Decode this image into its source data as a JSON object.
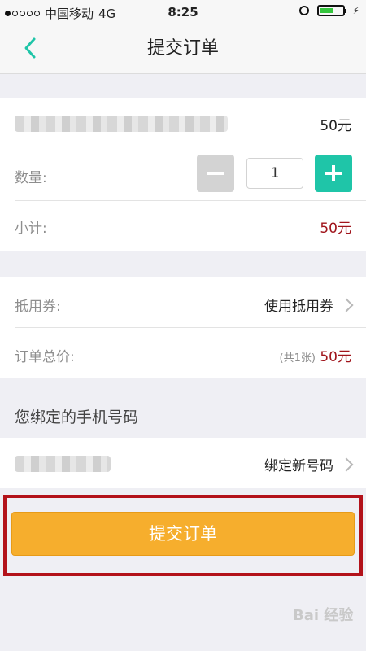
{
  "status_bar": {
    "carrier": "中国移动",
    "network": "4G",
    "time": "8:25"
  },
  "header": {
    "title": "提交订单",
    "back_icon": "chevron-left-icon"
  },
  "order": {
    "price": "50元",
    "quantity_label": "数量:",
    "quantity_value": "1",
    "subtotal_label": "小计:",
    "subtotal_value": "50元"
  },
  "coupon": {
    "label": "抵用券:",
    "action": "使用抵用券"
  },
  "total": {
    "label": "订单总价:",
    "count": "(共1张)",
    "value": "50元"
  },
  "phone": {
    "section_title": "您绑定的手机号码",
    "action": "绑定新号码"
  },
  "submit_button": "提交订单",
  "watermark": "Bai 经验",
  "colors": {
    "accent": "#1fc5a8",
    "submit": "#f6ae2d",
    "price_red": "#a0141b",
    "highlight": "#b3121a"
  }
}
